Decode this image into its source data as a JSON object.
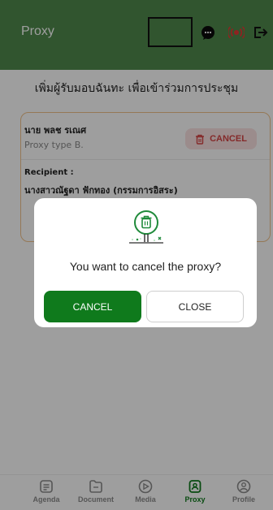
{
  "app": {
    "title": "Proxy"
  },
  "page": {
    "title": "เพิ่มผู้รับมอบฉันทะ เพื่อเข้าร่วมการประชุม"
  },
  "proxy_card": {
    "name": "นาย พลช รเณศ",
    "type": "Proxy type B.",
    "cancel_label": "CANCEL",
    "recipient_label": "Recipient :",
    "recipient_name": "นางสาวณัฐดา ฟักทอง (กรรมการอิสระ)"
  },
  "modal": {
    "question": "You want to cancel the proxy?",
    "cancel_label": "CANCEL",
    "close_label": "CLOSE"
  },
  "nav": {
    "items": [
      {
        "label": "Agenda",
        "icon": "agenda-icon"
      },
      {
        "label": "Document",
        "icon": "document-icon"
      },
      {
        "label": "Media",
        "icon": "media-icon"
      },
      {
        "label": "Proxy",
        "icon": "proxy-icon",
        "active": true
      },
      {
        "label": "Profile",
        "icon": "profile-icon"
      }
    ]
  },
  "colors": {
    "header": "#4f8a4c",
    "primary": "#0f7a1c",
    "danger": "#d64545",
    "card_border": "#f1c28b"
  }
}
